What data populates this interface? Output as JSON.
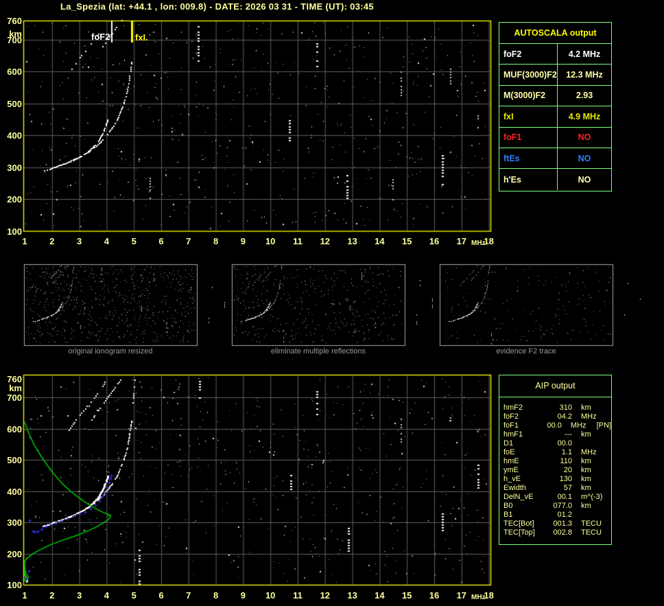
{
  "title": "La_Spezia (lat: +44.1 , lon: 009.8) - DATE: 2026 03 31 - TIME (UT): 03:45",
  "plot_labels": {
    "foF2_marker": "foF2",
    "fxI_marker": "fxI.",
    "y_unit": "km",
    "x_unit": "MHz"
  },
  "axes": {
    "x_ticks": [
      "1",
      "2",
      "3",
      "4",
      "5",
      "6",
      "7",
      "8",
      "9",
      "10",
      "11",
      "12",
      "13",
      "14",
      "15",
      "16",
      "17",
      "18"
    ],
    "y_ticks": [
      "760",
      "700",
      "600",
      "500",
      "400",
      "300",
      "200",
      "100"
    ]
  },
  "autoscala_table": {
    "header": "AUTOSCALA output",
    "rows": [
      {
        "label": "foF2",
        "value": "4.2 MHz",
        "color": "#ffffff"
      },
      {
        "label": "MUF(3000)F2",
        "value": "12.3 MHz",
        "color": "#ffffa8"
      },
      {
        "label": "M(3000)F2",
        "value": "2.93",
        "color": "#ffffa8"
      },
      {
        "label": "fxI",
        "value": "4.9 MHz",
        "color": "#e8e800"
      },
      {
        "label": "foF1",
        "value": "NO",
        "color": "#ff2020"
      },
      {
        "label": "ftEs",
        "value": "NO",
        "color": "#2f7fff"
      },
      {
        "label": "h'Es",
        "value": "NO",
        "color": "#ffffa8"
      }
    ]
  },
  "aip_table": {
    "header": "AIP output",
    "rows": [
      {
        "name": "hmF2",
        "value": "310",
        "unit": "km",
        "extra": ""
      },
      {
        "name": "foF2",
        "value": "04.2",
        "unit": "MHz",
        "extra": ""
      },
      {
        "name": "foF1",
        "value": "00.0",
        "unit": "MHz",
        "extra": "[PN]"
      },
      {
        "name": "hmF1",
        "value": "---",
        "unit": "km",
        "extra": ""
      },
      {
        "name": "D1",
        "value": "00.0",
        "unit": "",
        "extra": ""
      },
      {
        "name": "foE",
        "value": "1.1",
        "unit": "MHz",
        "extra": ""
      },
      {
        "name": "hmE",
        "value": "110",
        "unit": "km",
        "extra": ""
      },
      {
        "name": "ymE",
        "value": "20",
        "unit": "km",
        "extra": ""
      },
      {
        "name": "h_vE",
        "value": "130",
        "unit": "km",
        "extra": ""
      },
      {
        "name": "Ewidth",
        "value": "57",
        "unit": "km",
        "extra": ""
      },
      {
        "name": "DelN_vE",
        "value": "00.1",
        "unit": "m^(-3)",
        "extra": ""
      },
      {
        "name": "B0",
        "value": "077.0",
        "unit": "km",
        "extra": ""
      },
      {
        "name": "B1",
        "value": "01.2",
        "unit": "",
        "extra": ""
      },
      {
        "name": "TEC[Bot]",
        "value": "001.3",
        "unit": "TECU",
        "extra": ""
      },
      {
        "name": "TEC[Top]",
        "value": "002.8",
        "unit": "TECU",
        "extra": ""
      }
    ]
  },
  "thumbnails": [
    {
      "caption": "original ionogram resized"
    },
    {
      "caption": "eliminate multiple reflections"
    },
    {
      "caption": "evidence F2 trace"
    }
  ],
  "chart_data": {
    "type": "scatter",
    "x_axis": {
      "label": "MHz",
      "range": [
        1,
        18
      ]
    },
    "y_axis": {
      "label": "km",
      "range": [
        100,
        760
      ]
    },
    "markers": {
      "foF2_MHz": 4.2,
      "fxI_MHz": 4.93
    },
    "colors": {
      "border": "#f0f000",
      "grid": "#606060",
      "labels": "#ffff9e",
      "trace": "#ffffff",
      "profile_green": "#00cc00",
      "marker_blue": "#3030ff",
      "fof2_line": "#ffffff",
      "fxi_line": "#ffff00",
      "thumb_border": "#aaaaaa"
    },
    "o_trace": [
      [
        1.65,
        289
      ],
      [
        1.8,
        293
      ],
      [
        1.95,
        298
      ],
      [
        2.1,
        303
      ],
      [
        2.3,
        309
      ],
      [
        2.5,
        315
      ],
      [
        2.7,
        322
      ],
      [
        2.9,
        330
      ],
      [
        3.1,
        340
      ],
      [
        3.3,
        351
      ],
      [
        3.45,
        362
      ],
      [
        3.6,
        374
      ],
      [
        3.72,
        388
      ],
      [
        3.82,
        404
      ],
      [
        3.9,
        421
      ],
      [
        3.97,
        437
      ],
      [
        4.02,
        450
      ]
    ],
    "x_trace": [
      [
        2.55,
        318
      ],
      [
        2.75,
        325
      ],
      [
        2.95,
        333
      ],
      [
        3.15,
        342
      ],
      [
        3.35,
        352
      ],
      [
        3.55,
        364
      ],
      [
        3.72,
        377
      ],
      [
        3.88,
        391
      ],
      [
        4.02,
        406
      ],
      [
        4.16,
        422
      ],
      [
        4.3,
        440
      ],
      [
        4.42,
        460
      ],
      [
        4.53,
        482
      ],
      [
        4.63,
        507
      ],
      [
        4.72,
        535
      ],
      [
        4.79,
        565
      ],
      [
        4.85,
        598
      ],
      [
        4.9,
        632
      ]
    ],
    "x_trace_ext": [
      [
        4.93,
        665
      ],
      [
        4.96,
        700
      ],
      [
        4.99,
        735
      ],
      [
        5.01,
        758
      ]
    ],
    "multiple_o": [
      [
        2.6,
        598
      ],
      [
        2.8,
        622
      ],
      [
        3.0,
        645
      ],
      [
        3.2,
        666
      ],
      [
        3.4,
        688
      ],
      [
        3.6,
        708
      ],
      [
        3.75,
        726
      ],
      [
        3.88,
        744
      ],
      [
        3.97,
        758
      ]
    ],
    "multiple_x": [
      [
        3.3,
        615
      ],
      [
        3.5,
        638
      ],
      [
        3.7,
        662
      ],
      [
        3.9,
        686
      ],
      [
        4.1,
        710
      ],
      [
        4.3,
        734
      ],
      [
        4.45,
        752
      ],
      [
        4.55,
        762
      ]
    ],
    "e_trace_bottom": [
      [
        0.98,
        135
      ],
      [
        1.02,
        126
      ],
      [
        1.08,
        118
      ],
      [
        1.05,
        110
      ]
    ],
    "green_profile": [
      [
        1.0,
        622
      ],
      [
        1.15,
        585
      ],
      [
        1.35,
        548
      ],
      [
        1.6,
        512
      ],
      [
        1.85,
        480
      ],
      [
        2.1,
        452
      ],
      [
        2.4,
        422
      ],
      [
        2.7,
        398
      ],
      [
        3.0,
        378
      ],
      [
        3.3,
        360
      ],
      [
        3.6,
        344
      ],
      [
        3.85,
        333
      ],
      [
        4.05,
        326
      ],
      [
        4.15,
        322
      ],
      [
        4.12,
        314
      ],
      [
        4.0,
        305
      ],
      [
        3.8,
        294
      ],
      [
        3.5,
        280
      ],
      [
        3.2,
        268
      ],
      [
        2.9,
        258
      ],
      [
        2.6,
        249
      ],
      [
        2.3,
        240
      ],
      [
        2.0,
        230
      ],
      [
        1.7,
        218
      ],
      [
        1.45,
        207
      ],
      [
        1.25,
        196
      ],
      [
        1.1,
        186
      ],
      [
        1.0,
        176
      ],
      [
        1.0,
        150
      ]
    ],
    "green_e_loop": [
      [
        1.0,
        150
      ],
      [
        1.04,
        140
      ],
      [
        1.1,
        131
      ],
      [
        1.14,
        124
      ],
      [
        1.1,
        117
      ],
      [
        1.03,
        112
      ],
      [
        1.0,
        114
      ],
      [
        1.02,
        120
      ],
      [
        1.06,
        126
      ],
      [
        1.0,
        133
      ]
    ],
    "blue_markers": [
      [
        1.17,
        306
      ],
      [
        1.3,
        272
      ],
      [
        1.38,
        269
      ],
      [
        1.48,
        272
      ],
      [
        1.62,
        279
      ],
      [
        1.78,
        286
      ],
      [
        1.95,
        293
      ],
      [
        2.12,
        299
      ],
      [
        2.32,
        305
      ],
      [
        2.55,
        312
      ],
      [
        2.78,
        319
      ],
      [
        3.0,
        326
      ],
      [
        3.2,
        334
      ],
      [
        3.4,
        344
      ],
      [
        3.58,
        356
      ],
      [
        3.73,
        369
      ],
      [
        3.85,
        383
      ],
      [
        3.94,
        398
      ],
      [
        4.02,
        413
      ],
      [
        4.08,
        427
      ],
      [
        4.13,
        440
      ],
      [
        4.17,
        450
      ],
      [
        1.15,
        145
      ],
      [
        1.08,
        120
      ]
    ],
    "rfi_streaks_top": [
      [
        5.6,
        205,
        275,
        0
      ],
      [
        7.35,
        635,
        745,
        1
      ],
      [
        10.7,
        385,
        450,
        1
      ],
      [
        11.7,
        618,
        700,
        1
      ],
      [
        12.8,
        205,
        285,
        1
      ],
      [
        14.5,
        200,
        265,
        0
      ],
      [
        14.8,
        528,
        615,
        0
      ],
      [
        16.3,
        248,
        340,
        1
      ],
      [
        16.6,
        565,
        610,
        0
      ],
      [
        17.6,
        418,
        465,
        0
      ]
    ],
    "rfi_streaks_bottom": [
      [
        5.2,
        105,
        215,
        1
      ],
      [
        7.4,
        700,
        755,
        1
      ],
      [
        10.75,
        398,
        460,
        1
      ],
      [
        11.7,
        648,
        722,
        1
      ],
      [
        12.85,
        210,
        295,
        1
      ],
      [
        14.8,
        560,
        640,
        0
      ],
      [
        16.3,
        275,
        350,
        1
      ],
      [
        16.6,
        600,
        640,
        0
      ],
      [
        17.6,
        412,
        490,
        1
      ]
    ],
    "noise": {
      "seed_top": 101,
      "seed_bottom": 202,
      "top_count": 560,
      "bottom_count": 560,
      "thumb_seeds": [
        11,
        22,
        33
      ],
      "thumb_counts": [
        650,
        420,
        160
      ]
    }
  }
}
